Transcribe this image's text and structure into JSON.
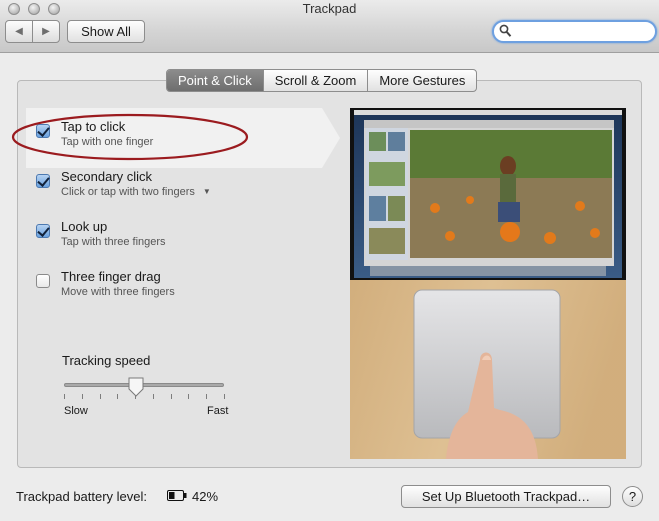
{
  "window": {
    "title": "Trackpad"
  },
  "toolbar": {
    "back_icon": "back-arrow-icon",
    "forward_icon": "forward-arrow-icon",
    "show_all_label": "Show All",
    "search_value": "",
    "search_placeholder": ""
  },
  "tabs": [
    {
      "label": "Point & Click",
      "active": true
    },
    {
      "label": "Scroll & Zoom",
      "active": false
    },
    {
      "label": "More Gestures",
      "active": false
    }
  ],
  "options": [
    {
      "title": "Tap to click",
      "subtitle": "Tap with one finger",
      "checked": true,
      "selected": true,
      "has_dropdown": false
    },
    {
      "title": "Secondary click",
      "subtitle": "Click or tap with two fingers",
      "checked": true,
      "selected": false,
      "has_dropdown": true
    },
    {
      "title": "Look up",
      "subtitle": "Tap with three fingers",
      "checked": true,
      "selected": false,
      "has_dropdown": false
    },
    {
      "title": "Three finger drag",
      "subtitle": "Move with three fingers",
      "checked": false,
      "selected": false,
      "has_dropdown": false
    }
  ],
  "tracking": {
    "label": "Tracking speed",
    "min_label": "Slow",
    "max_label": "Fast",
    "value": 0.45,
    "ticks": 10
  },
  "preview": {
    "description_icon": "trackpad-tap-demo-image"
  },
  "footer": {
    "battery_label": "Trackpad battery level:",
    "battery_percent": "42%",
    "battery_level": 0.42,
    "setup_button_label": "Set Up Bluetooth Trackpad…",
    "help_label": "?"
  },
  "colors": {
    "accent": "#6aa2df",
    "highlight_ring": "#9b1b1f",
    "active_tab": "#7a7a7a"
  }
}
